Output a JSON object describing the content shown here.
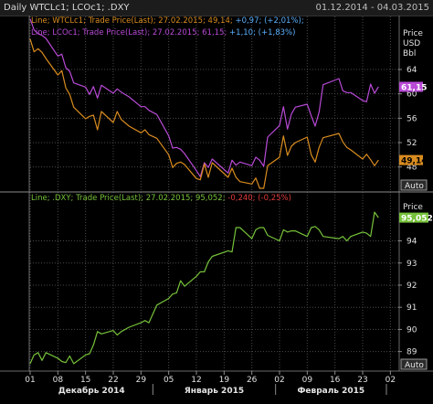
{
  "header": {
    "title": "Daily WTCLc1; LCOc1; .DXY",
    "date_range": "01.12.2014 - 04.03.2015"
  },
  "colors": {
    "background": "#000000",
    "wti": "#d98c1f",
    "brent": "#b84ad6",
    "dxy": "#76c23a",
    "up": "#5bb1ff",
    "down": "#e23b3b",
    "grid": "#4a4a4a"
  },
  "top_panel": {
    "legend_line1": {
      "prefix": "Line; WTCLc1; Trade Price(Last); 27.02.2015; 49,14;",
      "change": " +0,97; (+2,01%);"
    },
    "legend_line2": {
      "prefix": "Line; LCOc1; Trade Price(Last); 27.02.2015; 61,15;",
      "change": " +1,10; (+1,83%)"
    },
    "axis_title": [
      "Price",
      "USD",
      "Bbl"
    ],
    "last_brent": "61,15",
    "last_wti": "49,14",
    "auto_button": "Auto"
  },
  "bottom_panel": {
    "legend": {
      "prefix": "Line; .DXY; Trade Price(Last); 27.02.2015; 95,052;",
      "change": " -0,240; (-0,25%)"
    },
    "axis_title": "Price",
    "last_dxy": "95,052",
    "auto_button": "Auto"
  },
  "x_axis": {
    "day_labels": [
      "01",
      "08",
      "15",
      "22",
      "29",
      "05",
      "12",
      "19",
      "26",
      "02",
      "09",
      "16",
      "23",
      "02"
    ],
    "month_labels": [
      "Декабрь 2014",
      "Январь 2015",
      "Февраль 2015"
    ]
  },
  "chart_data": [
    {
      "type": "line",
      "title": "WTCLc1; LCOc1",
      "ylabel": "Price USD Bbl",
      "yticks": [
        48,
        52,
        56,
        60,
        64
      ],
      "ylim": [
        44.5,
        68.8
      ],
      "x": [
        "2014-12-01",
        "2014-12-02",
        "2014-12-03",
        "2014-12-04",
        "2014-12-05",
        "2014-12-08",
        "2014-12-09",
        "2014-12-10",
        "2014-12-11",
        "2014-12-12",
        "2014-12-15",
        "2014-12-16",
        "2014-12-17",
        "2014-12-18",
        "2014-12-19",
        "2014-12-22",
        "2014-12-23",
        "2014-12-24",
        "2014-12-26",
        "2014-12-29",
        "2014-12-30",
        "2014-12-31",
        "2015-01-02",
        "2015-01-05",
        "2015-01-06",
        "2015-01-07",
        "2015-01-08",
        "2015-01-09",
        "2015-01-12",
        "2015-01-13",
        "2015-01-14",
        "2015-01-15",
        "2015-01-16",
        "2015-01-20",
        "2015-01-21",
        "2015-01-22",
        "2015-01-23",
        "2015-01-26",
        "2015-01-27",
        "2015-01-28",
        "2015-01-29",
        "2015-01-30",
        "2015-02-02",
        "2015-02-03",
        "2015-02-04",
        "2015-02-05",
        "2015-02-06",
        "2015-02-09",
        "2015-02-10",
        "2015-02-11",
        "2015-02-12",
        "2015-02-13",
        "2015-02-17",
        "2015-02-18",
        "2015-02-19",
        "2015-02-20",
        "2015-02-23",
        "2015-02-24",
        "2015-02-25",
        "2015-02-26",
        "2015-02-27"
      ],
      "series": [
        {
          "name": "LCOc1",
          "values": [
            72.3,
            70.5,
            69.9,
            69.6,
            69.1,
            66.2,
            66.5,
            64.3,
            63.7,
            61.8,
            61.1,
            59.9,
            61.2,
            59.3,
            61.4,
            60.1,
            60.8,
            60.3,
            59.5,
            57.9,
            57.9,
            57.3,
            56.6,
            53.1,
            51.1,
            51.2,
            50.9,
            50.2,
            47.4,
            46.4,
            48.7,
            47.9,
            49.3,
            47.0,
            49.1,
            48.3,
            48.8,
            48.2,
            49.6,
            49.1,
            48.1,
            52.9,
            54.8,
            57.9,
            54.2,
            56.7,
            57.8,
            58.3,
            56.4,
            54.7,
            57.0,
            61.5,
            62.5,
            60.5,
            60.2,
            60.2,
            58.9,
            58.7,
            61.6,
            60.1,
            61.15
          ]
        },
        {
          "name": "WTCLc1",
          "values": [
            69.0,
            66.9,
            67.4,
            66.8,
            65.8,
            63.1,
            63.8,
            61.0,
            59.9,
            57.8,
            55.9,
            56.3,
            56.5,
            54.1,
            57.1,
            55.3,
            57.1,
            55.8,
            54.7,
            53.6,
            54.1,
            53.3,
            52.7,
            50.0,
            47.9,
            48.6,
            48.8,
            48.4,
            46.1,
            45.9,
            48.5,
            46.3,
            48.7,
            46.3,
            47.8,
            46.3,
            45.6,
            45.2,
            46.2,
            44.5,
            44.5,
            48.2,
            49.6,
            53.1,
            49.9,
            51.4,
            52.0,
            52.9,
            50.0,
            48.8,
            51.2,
            52.8,
            53.5,
            52.1,
            51.2,
            50.8,
            49.3,
            50.1,
            49.2,
            48.2,
            49.14
          ]
        }
      ]
    },
    {
      "type": "line",
      "title": ".DXY",
      "ylabel": "Price",
      "yticks": [
        89,
        90,
        91,
        92,
        93,
        94
      ],
      "ylim": [
        88.2,
        95.55
      ],
      "x": [
        "2014-12-01",
        "2014-12-02",
        "2014-12-03",
        "2014-12-04",
        "2014-12-05",
        "2014-12-08",
        "2014-12-09",
        "2014-12-10",
        "2014-12-11",
        "2014-12-12",
        "2014-12-15",
        "2014-12-16",
        "2014-12-17",
        "2014-12-18",
        "2014-12-19",
        "2014-12-22",
        "2014-12-23",
        "2014-12-24",
        "2014-12-26",
        "2014-12-29",
        "2014-12-30",
        "2014-12-31",
        "2015-01-02",
        "2015-01-05",
        "2015-01-06",
        "2015-01-07",
        "2015-01-08",
        "2015-01-09",
        "2015-01-12",
        "2015-01-13",
        "2015-01-14",
        "2015-01-15",
        "2015-01-16",
        "2015-01-20",
        "2015-01-21",
        "2015-01-22",
        "2015-01-23",
        "2015-01-26",
        "2015-01-27",
        "2015-01-28",
        "2015-01-29",
        "2015-01-30",
        "2015-02-02",
        "2015-02-03",
        "2015-02-04",
        "2015-02-05",
        "2015-02-06",
        "2015-02-09",
        "2015-02-10",
        "2015-02-11",
        "2015-02-12",
        "2015-02-13",
        "2015-02-17",
        "2015-02-18",
        "2015-02-19",
        "2015-02-20",
        "2015-02-23",
        "2015-02-24",
        "2015-02-25",
        "2015-02-26",
        "2015-02-27"
      ],
      "series": [
        {
          "name": ".DXY",
          "values": [
            88.45,
            88.85,
            88.95,
            88.6,
            88.95,
            88.7,
            88.55,
            88.5,
            88.8,
            88.45,
            88.85,
            88.9,
            89.3,
            89.9,
            89.8,
            89.95,
            89.75,
            89.9,
            90.1,
            90.3,
            90.4,
            90.3,
            91.1,
            91.4,
            91.6,
            91.65,
            92.2,
            91.95,
            92.4,
            92.6,
            92.6,
            93.05,
            93.3,
            93.55,
            93.5,
            94.6,
            94.6,
            94.1,
            94.5,
            94.6,
            94.6,
            94.25,
            94.0,
            94.5,
            94.4,
            94.45,
            94.45,
            94.2,
            94.6,
            94.65,
            94.5,
            94.2,
            94.1,
            94.2,
            94.0,
            94.2,
            94.4,
            94.35,
            94.2,
            95.3,
            95.05
          ]
        }
      ]
    }
  ]
}
